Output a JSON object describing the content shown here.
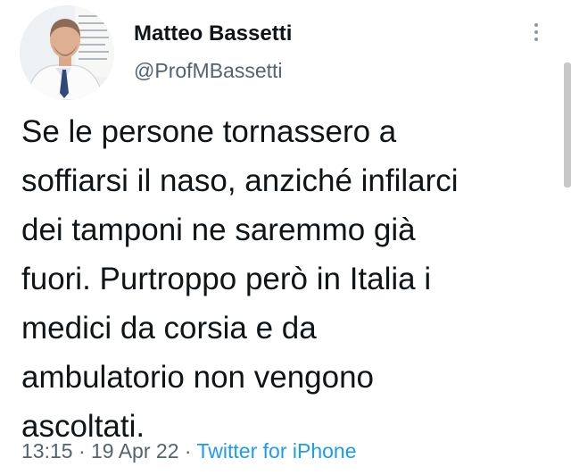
{
  "author": {
    "name": "Matteo Bassetti",
    "handle": "@ProfMBassetti",
    "avatar_icon": "profile-photo"
  },
  "tweet": {
    "lines": [
      "Se le persone tornassero a",
      "soffiarsi il naso, anziché infilarci",
      "dei tamponi ne saremmo già",
      "fuori. Purtroppo però in Italia i",
      "medici da corsia e da",
      "ambulatorio non vengono",
      "ascoltati."
    ]
  },
  "meta": {
    "time": "13:15",
    "sep1": " · ",
    "date": "19 Apr 22",
    "sep2": " · ",
    "source": "Twitter for iPhone"
  },
  "colors": {
    "text": "#0f1419",
    "secondary": "#536471",
    "link": "#1d9bf0"
  }
}
